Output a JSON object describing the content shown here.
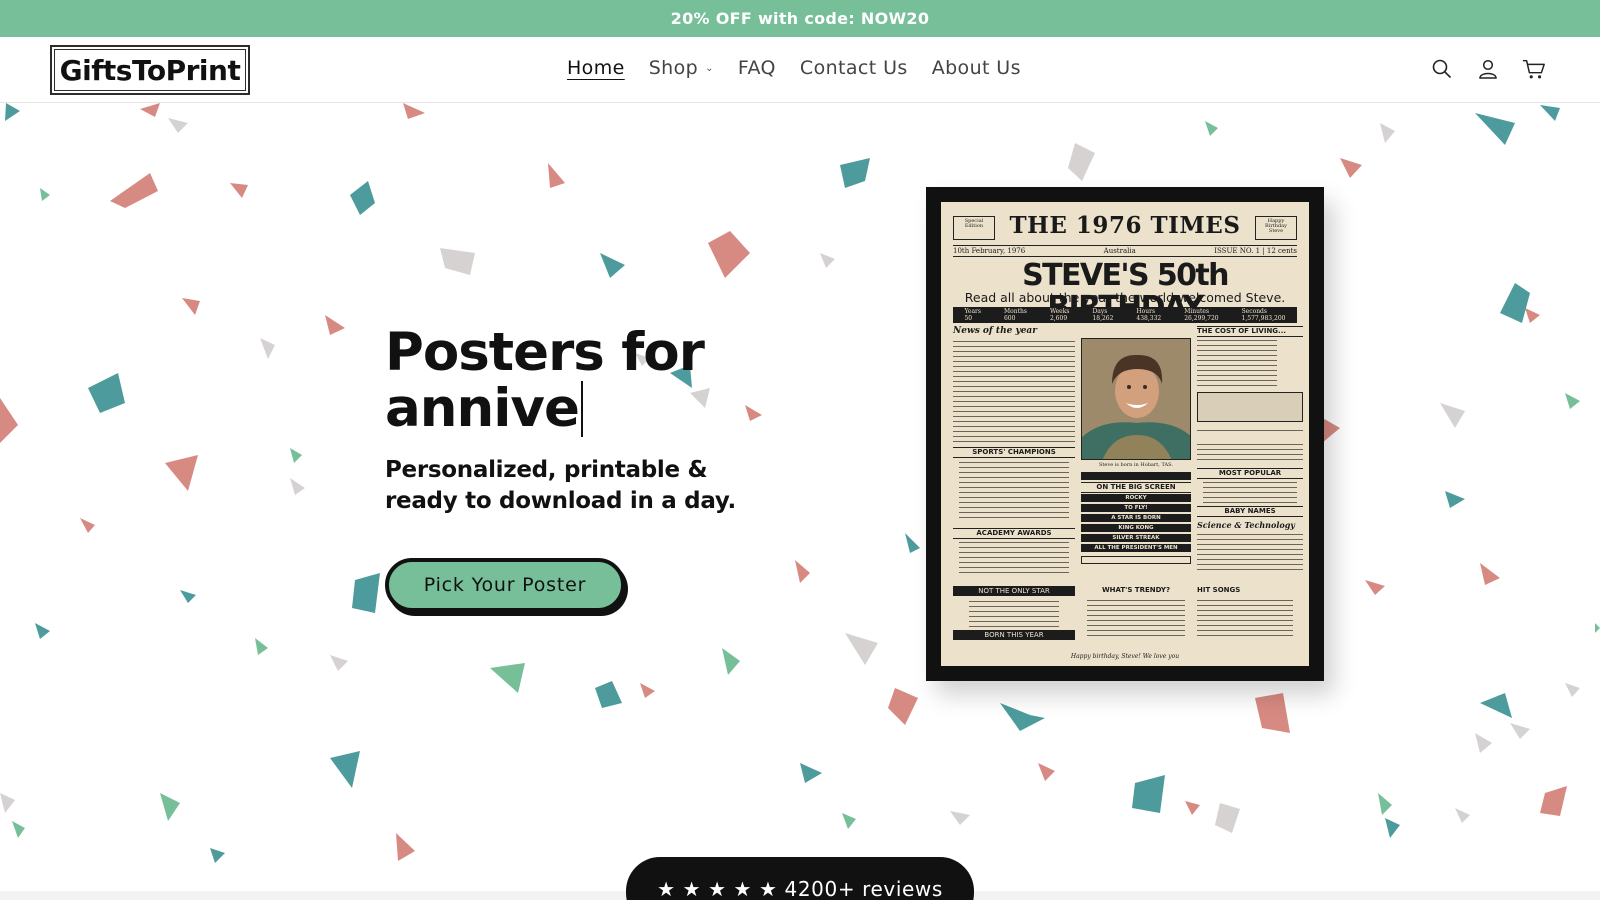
{
  "announcement": {
    "text": "20% OFF with code: NOW20"
  },
  "header": {
    "logo": "GiftsToPrint",
    "nav": [
      {
        "label": "Home",
        "active": true
      },
      {
        "label": "Shop",
        "has_dropdown": true
      },
      {
        "label": "FAQ"
      },
      {
        "label": "Contact Us"
      },
      {
        "label": "About Us"
      }
    ],
    "icons": [
      "search-icon",
      "account-icon",
      "cart-icon"
    ]
  },
  "hero": {
    "title_line1": "Posters for",
    "title_line2": "annive",
    "subtitle_line1": "Personalized, printable &",
    "subtitle_line2": "ready to download in a day.",
    "cta_label": "Pick Your Poster"
  },
  "poster": {
    "masthead": "THE 1976 TIMES",
    "corner_left": "Special Edition",
    "corner_right": "Happy Birthday Steve",
    "date": "10th February, 1976",
    "place": "Australia",
    "issue": "ISSUE NO. 1 | 12 cents",
    "headline": "STEVE'S 50th BIRTHDAY",
    "subhead": "Read all about the year the world welcomed Steve.",
    "stats": [
      {
        "label": "Years",
        "value": "50"
      },
      {
        "label": "Months",
        "value": "600"
      },
      {
        "label": "Weeks",
        "value": "2,609"
      },
      {
        "label": "Days",
        "value": "18,262"
      },
      {
        "label": "Hours",
        "value": "438,332"
      },
      {
        "label": "Minutes",
        "value": "26,299,720"
      },
      {
        "label": "Seconds",
        "value": "1,577,983,200"
      }
    ],
    "news_title": "News of the year",
    "cost_title": "THE COST OF LIVING...",
    "photo_caption": "Steve is born in Hobart, TAS.",
    "sports_title": "SPORTS' CHAMPIONS",
    "big_screen_title": "ON THE BIG SCREEN",
    "movies": [
      "ROCKY",
      "TO FLY!",
      "A STAR IS BORN",
      "KING KONG",
      "SILVER STREAK",
      "ALL THE PRESIDENT'S MEN"
    ],
    "popular_title": "MOST POPULAR",
    "baby_names_title": "BABY NAMES",
    "science_title": "Science & Technology",
    "awards_title": "ACADEMY AWARDS",
    "trendy_title": "WHAT'S TRENDY?",
    "hit_songs_title": "HIT SONGS",
    "not_only_star": "NOT THE ONLY STAR",
    "born_this_year": "BORN THIS YEAR",
    "footer": "Happy birthday, Steve! We love you"
  },
  "reviews": {
    "text": "★ ★ ★ ★ ★ 4200+ reviews"
  },
  "colors": {
    "brand_green": "#76bf99",
    "dark": "#111111"
  }
}
